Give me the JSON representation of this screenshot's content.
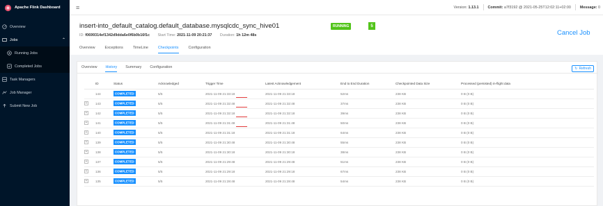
{
  "sidebar": {
    "brand": "Apache Flink Dashboard",
    "items": [
      {
        "label": "Overview",
        "icon": "dashboard-icon"
      },
      {
        "label": "Jobs",
        "icon": "jobs-icon"
      },
      {
        "label": "Running Jobs",
        "icon": "play-circle-icon"
      },
      {
        "label": "Completed Jobs",
        "icon": "check-circle-icon"
      },
      {
        "label": "Task Managers",
        "icon": "task-manager-icon"
      },
      {
        "label": "Job Manager",
        "icon": "job-manager-icon"
      },
      {
        "label": "Submit New Job",
        "icon": "upload-icon"
      }
    ]
  },
  "header": {
    "version_label": "Version:",
    "version": "1.13.1",
    "commit_label": "Commit:",
    "commit": "a7f3192 @ 2021-05-25T12:02:11+02:00",
    "message_label": "Message:",
    "message_count": "0"
  },
  "job": {
    "name": "insert-into_default_catalog.default_database.mysqlcdc_sync_hive01",
    "status": "RUNNING",
    "task_count": "5",
    "id_label": "ID:",
    "id": "f0699314ef1342d9dda6e0f6b0b16f1c",
    "start_label": "Start Time:",
    "start_time": "2021-11-09 20:21:37",
    "duration_label": "Duration:",
    "duration": "1h 12m 48s",
    "cancel_label": "Cancel Job",
    "tabs": [
      "Overview",
      "Exceptions",
      "TimeLine",
      "Checkpoints",
      "Configuration"
    ]
  },
  "checkpoints": {
    "subtabs": [
      "Overview",
      "History",
      "Summary",
      "Configuration"
    ],
    "refresh_label": "Refresh",
    "columns": [
      "ID",
      "Status",
      "Acknowledged",
      "Trigger Time",
      "Latest Acknowledgement",
      "End to End Duration",
      "Checkpointed Data Size",
      "Processed (persisted) in-flight data"
    ],
    "rows": [
      {
        "id": "144",
        "status": "COMPLETED",
        "ack": "5/5",
        "trigger": "2021-11-09 21:33:18",
        "latest": "2021-11-09 21:33:18",
        "duration": "52ms",
        "size": "238 KB",
        "inflight": "0 B (0 B)"
      },
      {
        "id": "143",
        "status": "COMPLETED",
        "ack": "5/5",
        "trigger": "2021-11-09 21:32:48",
        "latest": "2021-11-09 21:32:48",
        "duration": "37ms",
        "size": "238 KB",
        "inflight": "0 B (0 B)"
      },
      {
        "id": "142",
        "status": "COMPLETED",
        "ack": "5/5",
        "trigger": "2021-11-09 21:32:18",
        "latest": "2021-11-09 21:32:18",
        "duration": "39ms",
        "size": "238 KB",
        "inflight": "0 B (0 B)"
      },
      {
        "id": "141",
        "status": "COMPLETED",
        "ack": "5/5",
        "trigger": "2021-11-09 21:31:48",
        "latest": "2021-11-09 21:31:48",
        "duration": "50ms",
        "size": "238 KB",
        "inflight": "0 B (0 B)"
      },
      {
        "id": "140",
        "status": "COMPLETED",
        "ack": "5/5",
        "trigger": "2021-11-09 21:31:18",
        "latest": "2021-11-09 21:31:18",
        "duration": "64ms",
        "size": "238 KB",
        "inflight": "0 B (0 B)"
      },
      {
        "id": "139",
        "status": "COMPLETED",
        "ack": "5/5",
        "trigger": "2021-11-09 21:30:48",
        "latest": "2021-11-09 21:30:48",
        "duration": "55ms",
        "size": "238 KB",
        "inflight": "0 B (0 B)"
      },
      {
        "id": "138",
        "status": "COMPLETED",
        "ack": "5/5",
        "trigger": "2021-11-09 21:30:18",
        "latest": "2021-11-09 21:30:18",
        "duration": "38ms",
        "size": "238 KB",
        "inflight": "0 B (0 B)"
      },
      {
        "id": "137",
        "status": "COMPLETED",
        "ack": "5/5",
        "trigger": "2021-11-09 21:29:48",
        "latest": "2021-11-09 21:29:48",
        "duration": "51ms",
        "size": "238 KB",
        "inflight": "0 B (0 B)"
      },
      {
        "id": "136",
        "status": "COMPLETED",
        "ack": "5/5",
        "trigger": "2021-11-09 21:29:18",
        "latest": "2021-11-09 21:29:18",
        "duration": "67ms",
        "size": "238 KB",
        "inflight": "0 B (0 B)"
      },
      {
        "id": "135",
        "status": "COMPLETED",
        "ack": "5/5",
        "trigger": "2021-11-09 21:28:48",
        "latest": "2021-11-09 21:28:48",
        "duration": "54ms",
        "size": "238 KB",
        "inflight": "0 B (0 B)"
      }
    ]
  },
  "colors": {
    "sidebar": "#001529",
    "accent": "#1890ff",
    "running": "#52c41a",
    "annotation": "#e23b3b"
  }
}
